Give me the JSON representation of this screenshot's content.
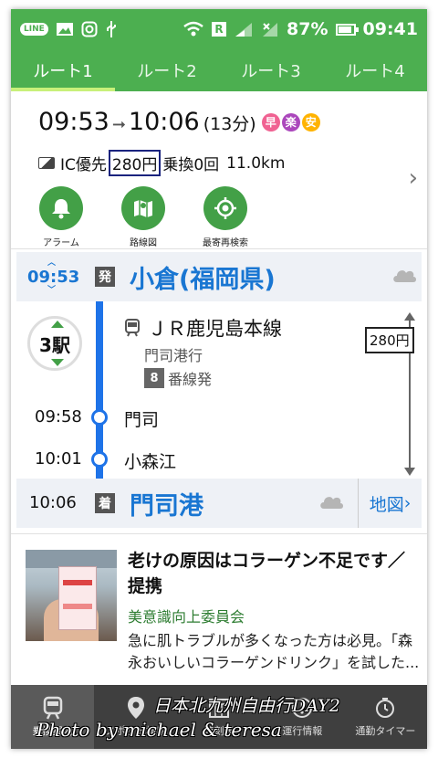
{
  "status_bar": {
    "app_icons": [
      "line-icon",
      "image-icon",
      "instagram-icon",
      "usb-icon"
    ],
    "battery_percent": "87%",
    "time": "09:41"
  },
  "tabs": [
    {
      "label": "ルート1",
      "active": true
    },
    {
      "label": "ルート2",
      "active": false
    },
    {
      "label": "ルート3",
      "active": false
    },
    {
      "label": "ルート4",
      "active": false
    }
  ],
  "summary": {
    "depart_time": "09:53",
    "arrive_time": "10:06",
    "duration": "(13分)",
    "badges": [
      {
        "label": "早",
        "color": "#f06292"
      },
      {
        "label": "楽",
        "color": "#ab47bc"
      },
      {
        "label": "安",
        "color": "#ffb300"
      }
    ],
    "ic_label": "IC優先",
    "fare": "280円",
    "transfers": "乗換0回",
    "distance": "11.0km"
  },
  "actions": [
    {
      "label": "アラーム",
      "icon": "bell-icon"
    },
    {
      "label": "路線図",
      "icon": "map-icon"
    },
    {
      "label": "最寄再検索",
      "icon": "location-target-icon"
    }
  ],
  "route": {
    "origin": {
      "time": "09:53",
      "tag": "発",
      "name": "小倉(福岡県)"
    },
    "station_count": "3駅",
    "train": {
      "line": "ＪＲ鹿児島本線",
      "direction": "門司港行",
      "platform_num": "8",
      "platform_label": "番線発"
    },
    "fare_side": "280円",
    "stops": [
      {
        "time": "09:58",
        "name": "門司"
      },
      {
        "time": "10:01",
        "name": "小森江"
      }
    ],
    "destination": {
      "time": "10:06",
      "tag": "着",
      "name": "門司港"
    },
    "map_link": "地図"
  },
  "ad": {
    "title": "老けの原因はコラーゲン不足です／提携",
    "source": "美意識向上委員会",
    "body": "急に肌トラブルが多くなった方は必見。「森永おいしいコラーゲンドリンク」を試した..."
  },
  "bottom_nav": [
    {
      "label": "乗換案内",
      "icon": "train-icon",
      "active": true
    },
    {
      "label": "スポット検索",
      "icon": "pin-icon",
      "active": false
    },
    {
      "label": "時刻表",
      "icon": "timetable-icon",
      "active": false
    },
    {
      "label": "運行情報",
      "icon": "service-info-icon",
      "active": false
    },
    {
      "label": "通勤タイマー",
      "icon": "timer-icon",
      "active": false
    }
  ],
  "watermark": {
    "line1": "日本北九州自由行DAY2",
    "line2": "Photo by michael & teresa"
  }
}
